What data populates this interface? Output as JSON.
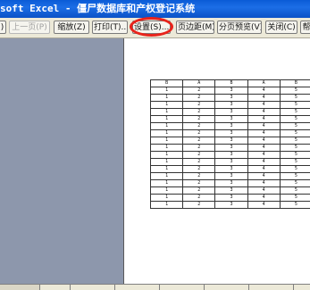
{
  "window": {
    "title": "soft Excel - 僵尸数据库和产权登记系统"
  },
  "toolbar": {
    "buttons": [
      {
        "label": ")"
      },
      {
        "label": "上一页(P)"
      },
      {
        "label": "缩放(Z)"
      },
      {
        "label": "打印(T)..."
      },
      {
        "label": "设置(S)..."
      },
      {
        "label": "页边距(M)"
      },
      {
        "label": "分页预览(V)"
      },
      {
        "label": "关闭(C)"
      },
      {
        "label": "帮"
      }
    ],
    "highlight_color": "#e8231b"
  },
  "sheet": {
    "header": [
      "B",
      "A",
      "B",
      "A",
      "B"
    ],
    "rows": [
      [
        "1",
        "2",
        "3",
        "4",
        "5"
      ],
      [
        "1",
        "2",
        "3",
        "4",
        "5"
      ],
      [
        "1",
        "2",
        "3",
        "4",
        "5"
      ],
      [
        "1",
        "2",
        "3",
        "4",
        "5"
      ],
      [
        "1",
        "2",
        "3",
        "4",
        "5"
      ],
      [
        "1",
        "2",
        "3",
        "4",
        "5"
      ],
      [
        "1",
        "2",
        "3",
        "4",
        "5"
      ],
      [
        "1",
        "2",
        "3",
        "4",
        "5"
      ],
      [
        "1",
        "2",
        "3",
        "4",
        "5"
      ],
      [
        "1",
        "2",
        "3",
        "4",
        "5"
      ],
      [
        "1",
        "2",
        "3",
        "4",
        "5"
      ],
      [
        "1",
        "2",
        "3",
        "4",
        "5"
      ],
      [
        "1",
        "2",
        "3",
        "4",
        "5"
      ],
      [
        "1",
        "2",
        "3",
        "4",
        "5"
      ],
      [
        "1",
        "2",
        "3",
        "4",
        "5"
      ],
      [
        "1",
        "2",
        "3",
        "4",
        "5"
      ],
      [
        "1",
        "2",
        "3",
        "4",
        "5"
      ]
    ]
  }
}
